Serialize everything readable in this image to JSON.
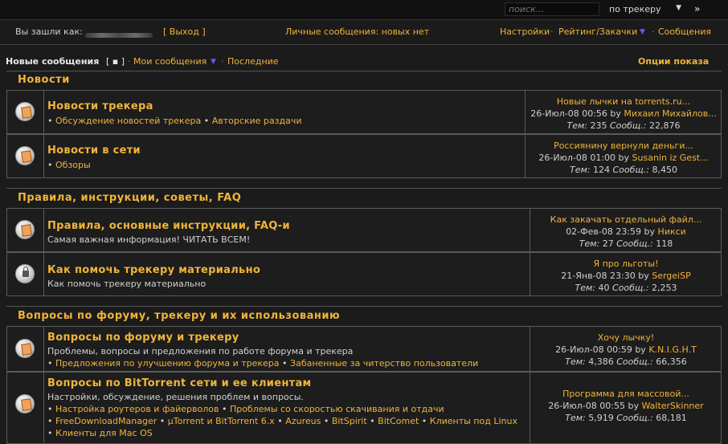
{
  "search": {
    "placeholder": "поиск...",
    "scope": "по трекеру",
    "go": "»"
  },
  "user": {
    "logged_as": "Вы зашли как:",
    "logout": "[ Выход ]",
    "pm": "Личные сообщения: новых нет",
    "settings": "Настройки",
    "rating": "Рейтинг/Закачки",
    "messages": "Сообщения"
  },
  "nav": {
    "new_posts": "Новые сообщения",
    "new_posts_bracket": "[ ▪ ]",
    "my_posts": "Мои сообщения",
    "latest": "Последние",
    "options": "Опции показа"
  },
  "categories": [
    {
      "title": "Новости",
      "forums": [
        {
          "title": "Новости трекера",
          "desc": "",
          "subforums": [
            "Обсуждение новостей трекера",
            "Авторские раздачи"
          ],
          "last_title": "Новые лычки на torrents.ru...",
          "last_date": "26-Июл-08 00:56",
          "last_user": "Михаил Михайлов...",
          "topics": "235",
          "posts": "22,876",
          "icon": "forum-read-icon"
        },
        {
          "title": "Новости в сети",
          "desc": "",
          "subforums": [
            "Обзоры"
          ],
          "last_title": "Россиянину вернули деньги...",
          "last_date": "26-Июл-08 01:00",
          "last_user": "Susanin iz Gest...",
          "topics": "124",
          "posts": "8,450",
          "icon": "forum-read-icon"
        }
      ]
    },
    {
      "title": "Правила, инструкции, советы, FAQ",
      "forums": [
        {
          "title": "Правила, основные инструкции, FAQ-и",
          "desc": "Самая важная информация! ЧИТАТЬ ВСЕМ!",
          "subforums": [],
          "last_title": "Как закачать отдельный файл...",
          "last_date": "02-Фев-08 23:59",
          "last_user": "Никси",
          "topics": "27",
          "posts": "118",
          "icon": "forum-read-icon"
        },
        {
          "title": "Как помочь трекеру материально",
          "desc": "Как помочь трекеру материально",
          "subforums": [],
          "last_title": "Я про льготы!",
          "last_date": "21-Янв-08 23:30",
          "last_user": "SergeiSP",
          "topics": "40",
          "posts": "2,253",
          "icon": "forum-locked-icon"
        }
      ]
    },
    {
      "title": "Вопросы по форуму, трекеру и их использованию",
      "forums": [
        {
          "title": "Вопросы по форуму и трекеру",
          "desc": "Проблемы, вопросы и предложения по работе форума и трекера",
          "subforums": [
            "Предложения по улучшению форума и трекера",
            "Забаненные за читерство пользователи"
          ],
          "last_title": "Хочу лычку!",
          "last_date": "26-Июл-08 00:59",
          "last_user": "K.N.I.G.H.T",
          "topics": "4,386",
          "posts": "66,356",
          "icon": "forum-read-icon"
        },
        {
          "title": "Вопросы по BitTorrent сети и ее клиентам",
          "desc": "Настройки, обсуждение, решения проблем и вопросы.",
          "subforums": [
            "Настройка роутеров и файерволов",
            "Проблемы со скоростью скачивания и отдачи",
            "FreeDownloadManager",
            "µTorrent и BitTorrent 6.x",
            "Azureus",
            "BitSpirit",
            "BitComet",
            "Клиенты под Linux",
            "Клиенты для Mac OS"
          ],
          "last_title": "Программа для массовой...",
          "last_date": "26-Июл-08 00:55",
          "last_user": "WalterSkinner",
          "topics": "5,919",
          "posts": "68,181",
          "icon": "forum-read-icon"
        }
      ]
    }
  ],
  "labels": {
    "by": "by",
    "topics": "Тем:",
    "posts": "Сообщ.:"
  }
}
